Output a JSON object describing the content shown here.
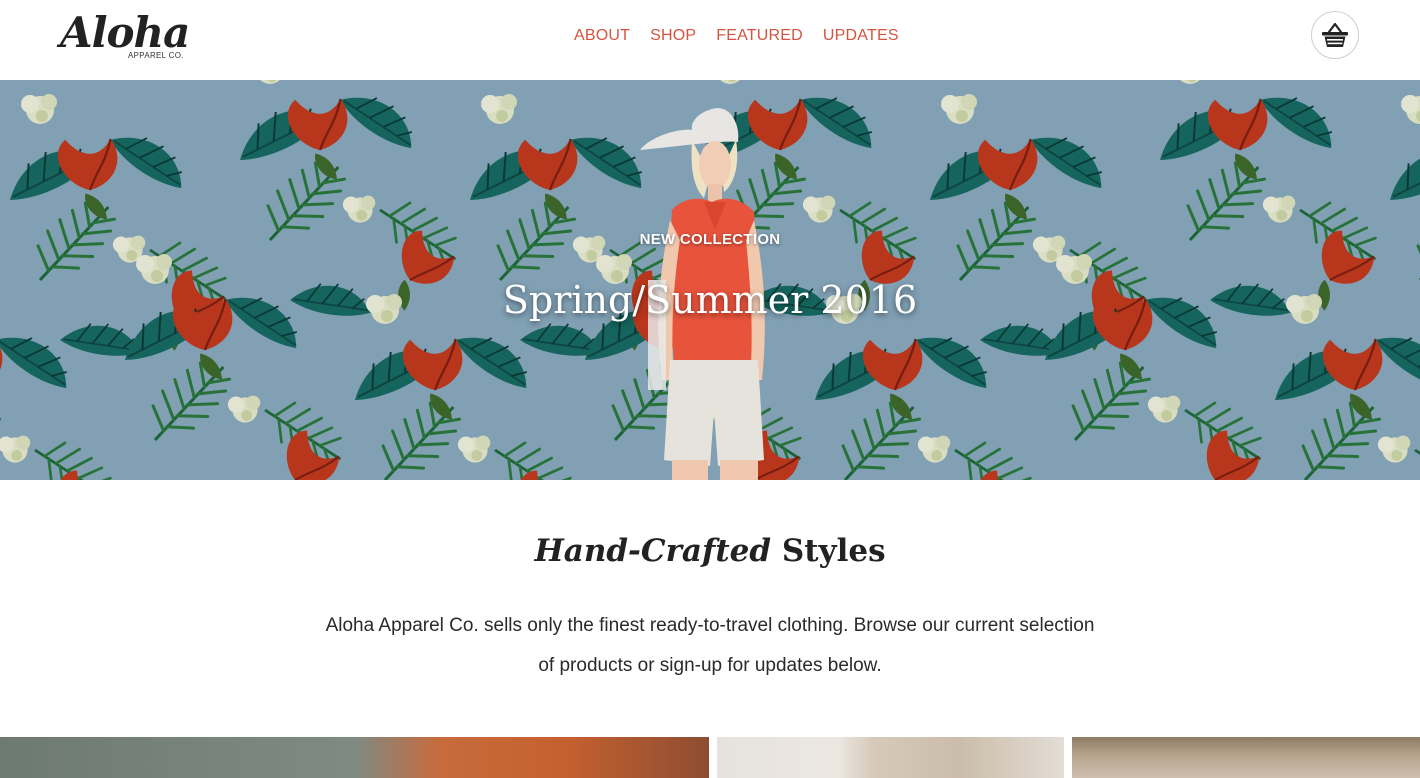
{
  "brand": {
    "logo_word": "Aloha",
    "logo_subtitle": "APPAREL CO."
  },
  "nav": {
    "items": [
      {
        "label": "ABOUT"
      },
      {
        "label": "SHOP"
      },
      {
        "label": "FEATURED"
      },
      {
        "label": "UPDATES"
      }
    ]
  },
  "cart": {
    "icon": "basket-icon"
  },
  "hero": {
    "eyebrow": "NEW COLLECTION",
    "title": "Spring/Summer 2016"
  },
  "intro": {
    "heading_italic": "Hand-Crafted",
    "heading_bold": "Styles",
    "text": "Aloha Apparel Co. sells only the finest ready-to-travel clothing. Browse our current selection of products or sign-up for updates below."
  },
  "colors": {
    "accent": "#d4553f",
    "hero_background": "#8aaac0",
    "text": "#222222"
  }
}
